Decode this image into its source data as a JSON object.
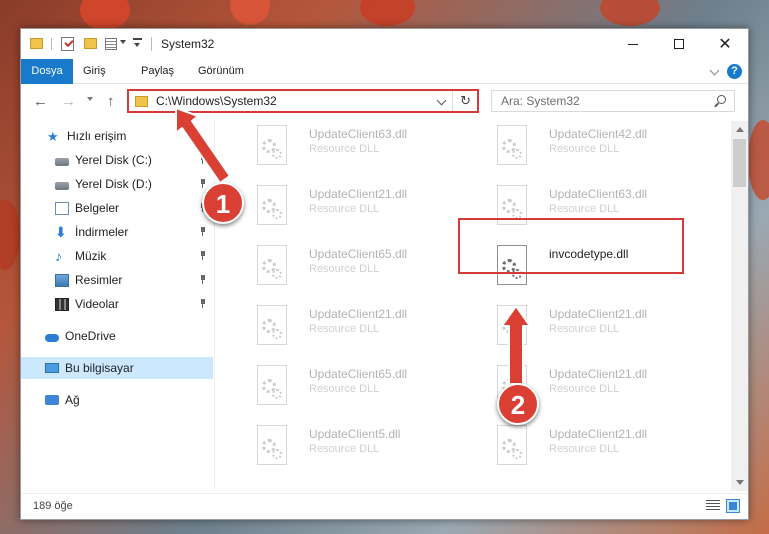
{
  "window": {
    "title": "System32",
    "close_glyph": "✕"
  },
  "ribbon": {
    "tabs": [
      "Dosya",
      "Giriş",
      "Paylaş",
      "Görünüm"
    ],
    "help_glyph": "?"
  },
  "navigation": {
    "back_glyph": "←",
    "forward_glyph": "→",
    "up_glyph": "↑",
    "refresh_glyph": "↻",
    "address": "C:\\Windows\\System32",
    "search_placeholder": "Ara: System32"
  },
  "sidebar": {
    "items": [
      {
        "label": "Hızlı erişim",
        "icon": "star-icon",
        "pinned": false
      },
      {
        "label": "Yerel Disk (C:)",
        "icon": "drive-icon",
        "pinned": true
      },
      {
        "label": "Yerel Disk (D:)",
        "icon": "drive-icon",
        "pinned": true
      },
      {
        "label": "Belgeler",
        "icon": "documents-icon",
        "pinned": true
      },
      {
        "label": "İndirmeler",
        "icon": "download-icon",
        "pinned": true
      },
      {
        "label": "Müzik",
        "icon": "music-icon",
        "pinned": true
      },
      {
        "label": "Resimler",
        "icon": "pictures-icon",
        "pinned": true
      },
      {
        "label": "Videolar",
        "icon": "videos-icon",
        "pinned": true
      },
      {
        "label": "OneDrive",
        "icon": "cloud-icon",
        "pinned": false
      },
      {
        "label": "Bu bilgisayar",
        "icon": "computer-icon",
        "pinned": false,
        "selected": true
      },
      {
        "label": "Ağ",
        "icon": "network-icon",
        "pinned": false
      }
    ],
    "star_glyph": "★",
    "download_glyph": "⬇",
    "music_glyph": "♪"
  },
  "files": [
    {
      "name": "UpdateClient63.dll",
      "type": "Resource DLL"
    },
    {
      "name": "UpdateClient42.dll",
      "type": "Resource DLL"
    },
    {
      "name": "UpdateClient21.dll",
      "type": "Resource DLL"
    },
    {
      "name": "UpdateClient63.dll",
      "type": "Resource DLL"
    },
    {
      "name": "UpdateClient65.dll",
      "type": "Resource DLL"
    },
    {
      "name": "invcodetype.dll",
      "type": "",
      "highlighted": true
    },
    {
      "name": "UpdateClient21.dll",
      "type": "Resource DLL"
    },
    {
      "name": "UpdateClient21.dll",
      "type": "Resource DLL"
    },
    {
      "name": "UpdateClient65.dll",
      "type": "Resource DLL"
    },
    {
      "name": "UpdateClient21.dll",
      "type": "Resource DLL"
    },
    {
      "name": "UpdateClient5.dll",
      "type": "Resource DLL"
    },
    {
      "name": "UpdateClient21.dll",
      "type": "Resource DLL"
    }
  ],
  "status": {
    "item_count": "189 öğe"
  },
  "annotations": {
    "step1": "1",
    "step2": "2",
    "color": "#d94033"
  },
  "colors": {
    "accent": "#1979ca",
    "highlight": "#d33b3b",
    "selected_bg": "#cce8ff"
  }
}
